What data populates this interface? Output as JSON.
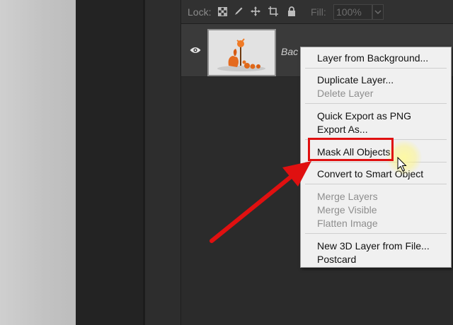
{
  "lock_bar": {
    "lock_label": "Lock:",
    "fill_label": "Fill:",
    "fill_value": "100%",
    "icons": [
      "lock-transparent-pixels-icon",
      "lock-image-pixels-icon",
      "lock-position-icon",
      "lock-artboard-icon",
      "lock-all-icon"
    ]
  },
  "layer": {
    "name": "Bac",
    "visibility_icon": "eye-icon"
  },
  "context_menu": {
    "items": [
      {
        "label": "Layer from Background...",
        "enabled": true
      },
      {
        "label": "Duplicate Layer...",
        "enabled": true
      },
      {
        "label": "Delete Layer",
        "enabled": false
      },
      {
        "label": "Quick Export as PNG",
        "enabled": true
      },
      {
        "label": "Export As...",
        "enabled": true
      },
      {
        "label": "Mask All Objects",
        "enabled": true,
        "highlighted": true
      },
      {
        "label": "Convert to Smart Object",
        "enabled": true
      },
      {
        "label": "Merge Layers",
        "enabled": false
      },
      {
        "label": "Merge Visible",
        "enabled": false
      },
      {
        "label": "Flatten Image",
        "enabled": false
      },
      {
        "label": "New 3D Layer from File...",
        "enabled": true
      },
      {
        "label": "Postcard",
        "enabled": true
      }
    ]
  },
  "annotation": {
    "highlight_color": "#e01010",
    "arrow_color": "#e01010"
  }
}
